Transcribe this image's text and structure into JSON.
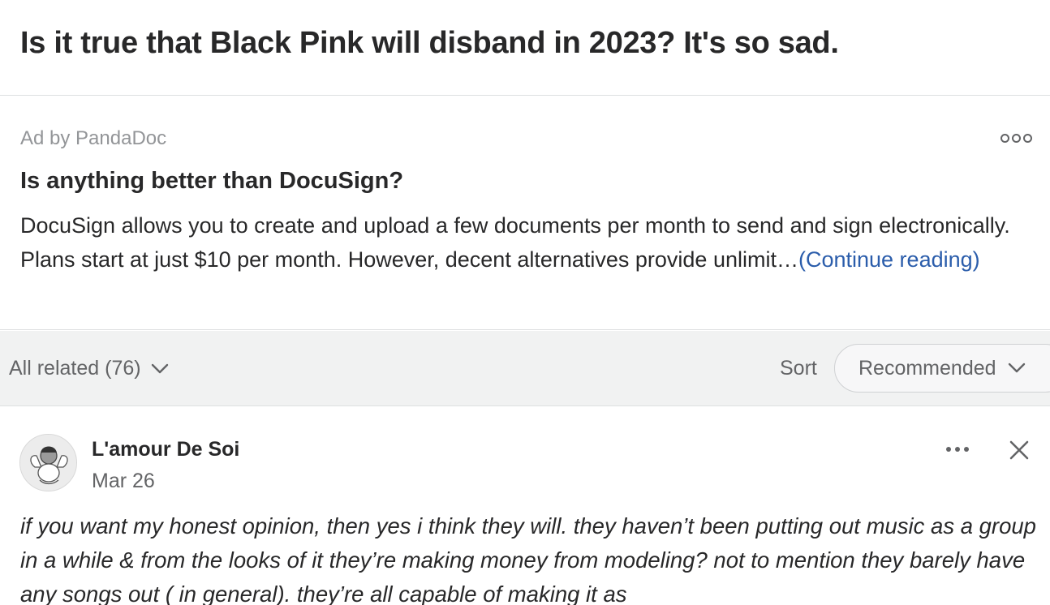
{
  "question": {
    "title": "Is it true that Black Pink will disband in 2023? It's so sad."
  },
  "ad": {
    "sponsor_label": "Ad by PandaDoc",
    "more_icon": "more-options-icon",
    "title": "Is anything better than DocuSign?",
    "body": "DocuSign allows you to create and upload a few documents per month to send and sign electronically. Plans start at just $10 per month. However, decent alternatives provide unlimit…",
    "continue_label": "(Continue reading)",
    "link_color": "#2b5dab"
  },
  "related_bar": {
    "filter_label": "All related (76)",
    "sort_label": "Sort",
    "sort_value": "Recommended"
  },
  "answer": {
    "author": "L'amour De Soi",
    "date": "Mar 26",
    "text": "if you want my honest opinion, then yes i think they will. they haven’t been putting out music as a group in a while & from the looks of it they’re making money from modeling? not to mention they barely have any songs out ( in general). they’re all capable of making it as"
  },
  "colors": {
    "text_primary": "#282829",
    "text_secondary": "#636466",
    "text_muted": "#939598",
    "bar_background": "#f1f2f2",
    "divider": "#dee0e1"
  }
}
